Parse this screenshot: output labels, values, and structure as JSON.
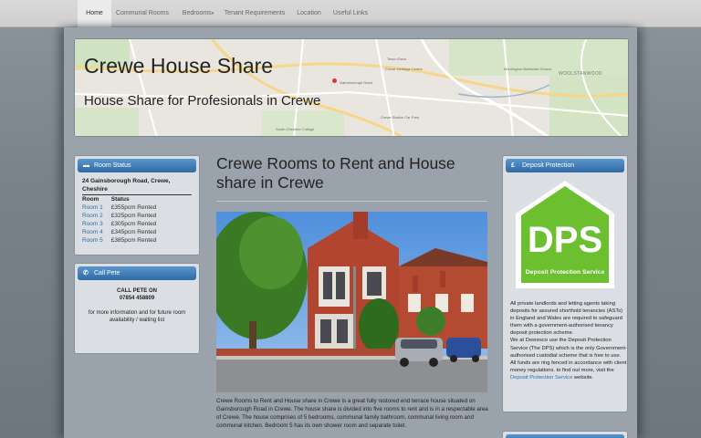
{
  "nav": {
    "items": [
      {
        "label": "Home",
        "active": true
      },
      {
        "label": "Communal Rooms"
      },
      {
        "label": "Bedrooms",
        "caret": "▾"
      },
      {
        "label": "Tenant Requirements"
      },
      {
        "label": "Location"
      },
      {
        "label": "Useful Links"
      }
    ]
  },
  "banner": {
    "title": "Crewe House Share",
    "subtitle": "House Share for Profesionals in Crewe",
    "map_labels": [
      "Tesco Extra",
      "Crewe Heritage Centre",
      "Gainsborough Road",
      "Mornington Methodist Church",
      "Crewe Station Car Park",
      "South Cheshire College",
      "WOOLSTANWOOD"
    ]
  },
  "room_status": {
    "header": "Room Status",
    "icon": "bed-icon",
    "address_line1": "24 Gainsborough Road, Crewe,",
    "address_line2": "Cheshire",
    "columns": [
      "Room",
      "Status"
    ],
    "rows": [
      {
        "room": "Room 1",
        "status": "£355pcm Rented"
      },
      {
        "room": "Room 2",
        "status": "£325pcm  Rented"
      },
      {
        "room": "Room 3",
        "status": "£305pcm Rented"
      },
      {
        "room": "Room 4",
        "status": "£345pcm Rented"
      },
      {
        "room": "Room 5",
        "status": "£385pcm Rented"
      }
    ]
  },
  "call": {
    "header": "Call Pete",
    "icon": "phone-icon",
    "line1": "CALL PETE ON",
    "line2": "07854 458809",
    "line3": "for more information and for future room",
    "line4": "availability / waiting list"
  },
  "main": {
    "heading": "Crewe Rooms to Rent and House share in Crewe",
    "body": "Crewe Rooms to Rent and House share in Crewe is a great fully restored end terrace house situated on Gainsborough Road in Crewe.  The house share is divided into five rooms to rent and is in a respectable area of Crewe.  The house comprises of 5 bedrooms, communal family bathroom, communal living room and communal kitchen.  Bedroom 5 has its own shower room and separate toilet."
  },
  "dps": {
    "header": "Deposit Protection",
    "icon_glyph": "£",
    "logo_text": "DPS",
    "logo_sub": "Deposit Protection Service",
    "para1": "All private landlords and letting agents taking deposits for assured shorthold tenancies (ASTs) in England and Wales are required to safeguard them with a government-authorised tenancy deposit protection scheme.",
    "para2_a": "We at Desresco use the Deposit Protection Service (The DPS) which is the only Government-authorised custodial scheme that is free to use.  All funds are ring fenced in accordance with client money regulations.  to find out more, visit the ",
    "para2_link": "Deposit Protection Service",
    "para2_b": " website.",
    "accent": "#6cbf2f"
  },
  "colors": {
    "nav_bg": "#d6d6d6",
    "panel_header": "#3a78b5",
    "link": "#2e6da4"
  }
}
